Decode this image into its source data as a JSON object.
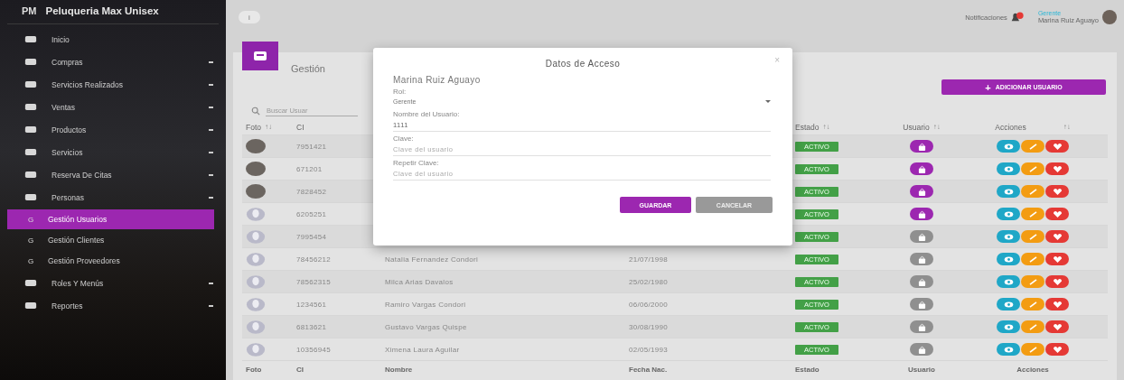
{
  "sidebar": {
    "brand_abbr": "PM",
    "brand": "Peluqueria Max Unisex",
    "items": [
      {
        "label": "Inicio",
        "expandable": false
      },
      {
        "label": "Compras",
        "expandable": true
      },
      {
        "label": "Servicios Realizados",
        "expandable": true
      },
      {
        "label": "Ventas",
        "expandable": true
      },
      {
        "label": "Productos",
        "expandable": true
      },
      {
        "label": "Servicios",
        "expandable": true
      },
      {
        "label": "Reserva De Citas",
        "expandable": true
      },
      {
        "label": "Personas",
        "expandable": true,
        "children": [
          {
            "abbr": "G",
            "label": "Gestión Usuarios",
            "selected": true
          },
          {
            "abbr": "G",
            "label": "Gestión Clientes",
            "selected": false
          },
          {
            "abbr": "G",
            "label": "Gestión Proveedores",
            "selected": false
          }
        ]
      },
      {
        "label": "Roles Y Menús",
        "expandable": true
      },
      {
        "label": "Reportes",
        "expandable": true
      }
    ]
  },
  "topbar": {
    "info_button": "i",
    "notifications": "Notificaciones",
    "user_role": "Gerente",
    "user_name": "Marina Ruiz Aguayo"
  },
  "card": {
    "title": "Gestión",
    "add_icon": "+",
    "add_button": "ADICIONAR USUARIO",
    "search": {
      "placeholder": "Buscar Usuar"
    },
    "header_left": [
      {
        "label": "Foto",
        "sort": "↑↓"
      },
      {
        "label": "CI"
      }
    ],
    "header_right": [
      {
        "label": "Estado",
        "sort": "↑↓"
      },
      {
        "label": "Usuario",
        "sort": "↑↓"
      },
      {
        "label": "Acciones",
        "sort": "↑↓"
      }
    ],
    "rows": [
      {
        "has_photo": true,
        "ci": "7951421",
        "estado": "ACTIVO",
        "user_active": true
      },
      {
        "has_photo": true,
        "ci": "671201",
        "estado": "ACTIVO",
        "user_active": true
      },
      {
        "has_photo": true,
        "ci": "7828452",
        "estado": "ACTIVO",
        "user_active": true
      },
      {
        "has_photo": false,
        "ci": "6205251",
        "estado": "ACTIVO",
        "user_active": true
      },
      {
        "has_photo": false,
        "ci": "7995454",
        "estado": "ACTIVO",
        "user_active": false
      },
      {
        "has_photo": false,
        "ci": "78456212",
        "nombre": "Natalia Fernandez Condori",
        "fecha": "21/07/1998",
        "estado": "ACTIVO",
        "user_active": false
      },
      {
        "has_photo": false,
        "ci": "78562315",
        "nombre": "Milca Arias Davalos",
        "fecha": "25/02/1980",
        "estado": "ACTIVO",
        "user_active": false
      },
      {
        "has_photo": false,
        "ci": "1234561",
        "nombre": "Ramiro Vargas Condori",
        "fecha": "06/06/2000",
        "estado": "ACTIVO",
        "user_active": false
      },
      {
        "has_photo": false,
        "ci": "6813621",
        "nombre": "Gustavo Vargas Quispe",
        "fecha": "30/08/1990",
        "estado": "ACTIVO",
        "user_active": false
      },
      {
        "has_photo": false,
        "ci": "10356945",
        "nombre": "Ximena Laura Aguilar",
        "fecha": "02/05/1993",
        "estado": "ACTIVO",
        "user_active": false
      }
    ],
    "footer": [
      "Foto",
      "CI",
      "Nombre",
      "Fecha Nac.",
      "Estado",
      "Usuario",
      "Acciones"
    ]
  },
  "modal": {
    "title": "Datos de Acceso",
    "close": "×",
    "person": "Marina Ruiz Aguayo",
    "role_label": "Rol:",
    "role_value": "Gerente",
    "username_label": "Nombre del Usuario:",
    "username_value": "1111",
    "password_label": "Clave:",
    "password_placeholder": "Clave del usuario",
    "repeat_label": "Repetir Clave:",
    "repeat_placeholder": "Clave del usuario",
    "save": "GUARDAR",
    "cancel": "CANCELAR"
  }
}
